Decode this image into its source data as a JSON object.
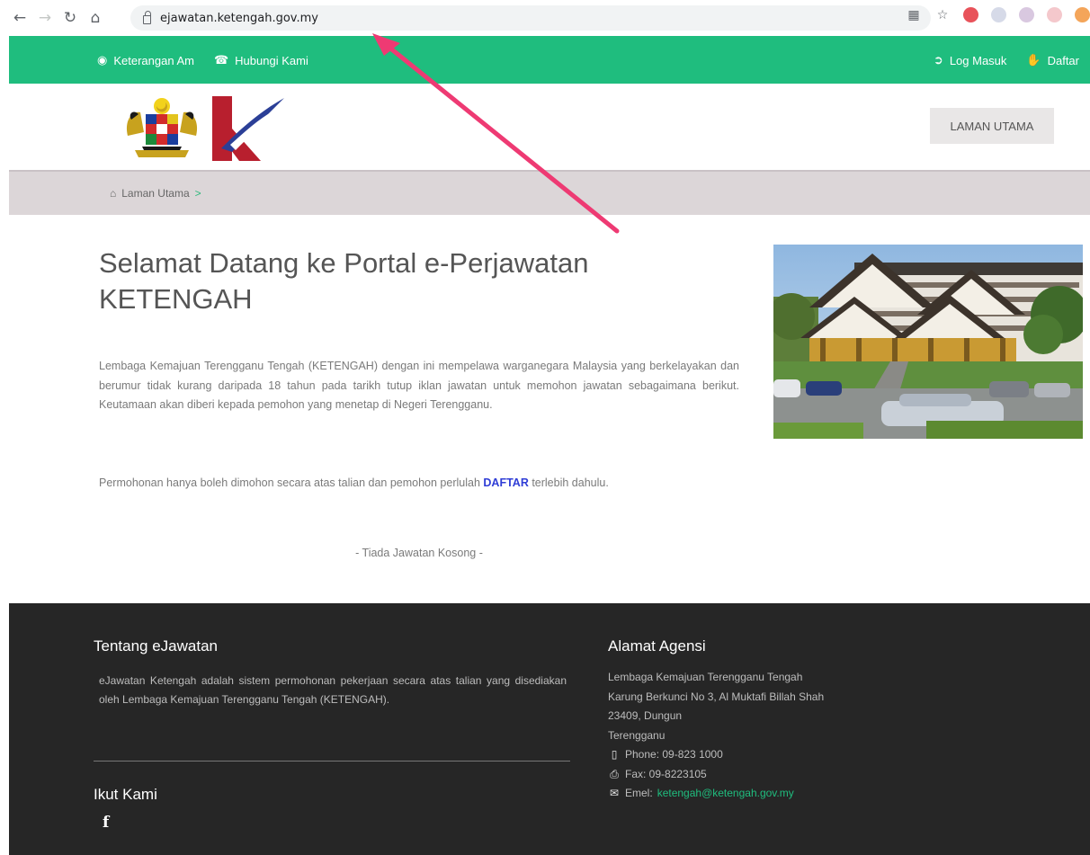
{
  "browser": {
    "url": "ejawatan.ketengah.gov.my",
    "icons": [
      "back-icon",
      "forward-icon",
      "reload-icon",
      "home-icon",
      "lock-icon",
      "translate-icon",
      "star-icon"
    ],
    "extension_colors": [
      "#e8525a",
      "#d6dae8",
      "#d9c8e0",
      "#f4c8cc",
      "#f4a55a"
    ]
  },
  "topbar": {
    "color": "#1fbd7e",
    "left_items": [
      {
        "label": "Keterangan Am",
        "icon": "info-chat-icon"
      },
      {
        "label": "Hubungi Kami",
        "icon": "phone-icon"
      }
    ],
    "right_items": [
      {
        "label": "Log Masuk",
        "icon": "sign-in-icon"
      },
      {
        "label": "Daftar",
        "icon": "thumbs-up-icon"
      }
    ]
  },
  "header": {
    "home_button": "LAMAN UTAMA"
  },
  "breadcrumb": {
    "label": "Laman Utama",
    "separator": ">"
  },
  "main": {
    "title": "Selamat Datang ke Portal e-Perjawatan KETENGAH",
    "paragraph1": "Lembaga Kemajuan Terengganu Tengah (KETENGAH) dengan ini mempelawa warganegara Malaysia yang berkelayakan dan berumur tidak kurang daripada 18 tahun pada tarikh tutup iklan jawatan untuk memohon jawatan sebagaimana berikut. Keutamaan akan diberi kepada pemohon yang menetap di Negeri Terengganu.",
    "paragraph2_before": "Permohonan hanya boleh dimohon secara atas talian dan pemohon perlulah ",
    "paragraph2_link": "DAFTAR",
    "paragraph2_after": " terlebih dahulu.",
    "no_vacancy": "- Tiada Jawatan Kosong -"
  },
  "footer": {
    "about_heading": "Tentang eJawatan",
    "about_text": "eJawatan Ketengah adalah sistem permohonan pekerjaan secara atas talian yang disediakan oleh Lembaga Kemajuan Terengganu Tengah (KETENGAH).",
    "follow_heading": "Ikut Kami",
    "facebook_label": "f",
    "address_heading": "Alamat Agensi",
    "address_lines": [
      "Lembaga Kemajuan Terengganu Tengah",
      "Karung Berkunci No 3, Al Muktafi Billah Shah",
      "23409, Dungun",
      "Terengganu"
    ],
    "phone": "Phone: 09-823 1000",
    "fax": "Fax: 09-8223105",
    "email_label": "Emel: ",
    "email": "ketengah@ketengah.gov.my"
  }
}
